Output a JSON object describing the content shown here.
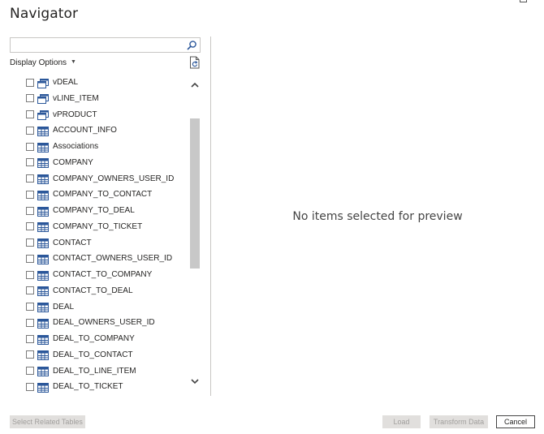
{
  "dialog": {
    "title": "Navigator"
  },
  "search": {
    "value": "",
    "placeholder": ""
  },
  "display_options": {
    "label": "Display Options"
  },
  "tree_items": [
    {
      "label": "vDEAL",
      "icon": "view-icon",
      "checked": false
    },
    {
      "label": "vLINE_ITEM",
      "icon": "view-icon",
      "checked": false
    },
    {
      "label": "vPRODUCT",
      "icon": "view-icon",
      "checked": false
    },
    {
      "label": "ACCOUNT_INFO",
      "icon": "table-icon",
      "checked": false
    },
    {
      "label": "Associations",
      "icon": "table-icon",
      "checked": false
    },
    {
      "label": "COMPANY",
      "icon": "table-icon",
      "checked": false
    },
    {
      "label": "COMPANY_OWNERS_USER_ID",
      "icon": "table-icon",
      "checked": false
    },
    {
      "label": "COMPANY_TO_CONTACT",
      "icon": "table-icon",
      "checked": false
    },
    {
      "label": "COMPANY_TO_DEAL",
      "icon": "table-icon",
      "checked": false
    },
    {
      "label": "COMPANY_TO_TICKET",
      "icon": "table-icon",
      "checked": false
    },
    {
      "label": "CONTACT",
      "icon": "table-icon",
      "checked": false
    },
    {
      "label": "CONTACT_OWNERS_USER_ID",
      "icon": "table-icon",
      "checked": false
    },
    {
      "label": "CONTACT_TO_COMPANY",
      "icon": "table-icon",
      "checked": false
    },
    {
      "label": "CONTACT_TO_DEAL",
      "icon": "table-icon",
      "checked": false
    },
    {
      "label": "DEAL",
      "icon": "table-icon",
      "checked": false
    },
    {
      "label": "DEAL_OWNERS_USER_ID",
      "icon": "table-icon",
      "checked": false
    },
    {
      "label": "DEAL_TO_COMPANY",
      "icon": "table-icon",
      "checked": false
    },
    {
      "label": "DEAL_TO_CONTACT",
      "icon": "table-icon",
      "checked": false
    },
    {
      "label": "DEAL_TO_LINE_ITEM",
      "icon": "table-icon",
      "checked": false
    },
    {
      "label": "DEAL_TO_TICKET",
      "icon": "table-icon",
      "checked": false
    }
  ],
  "preview": {
    "message": "No items selected for preview"
  },
  "buttons": {
    "select_related": "Select Related Tables",
    "load": "Load",
    "transform": "Transform Data",
    "cancel": "Cancel"
  },
  "colors": {
    "icon_blue": "#2b579a",
    "disabled_button_bg": "#e1dfdd",
    "disabled_button_text": "#a19f9d",
    "scroll_thumb": "#c8c8c8"
  }
}
